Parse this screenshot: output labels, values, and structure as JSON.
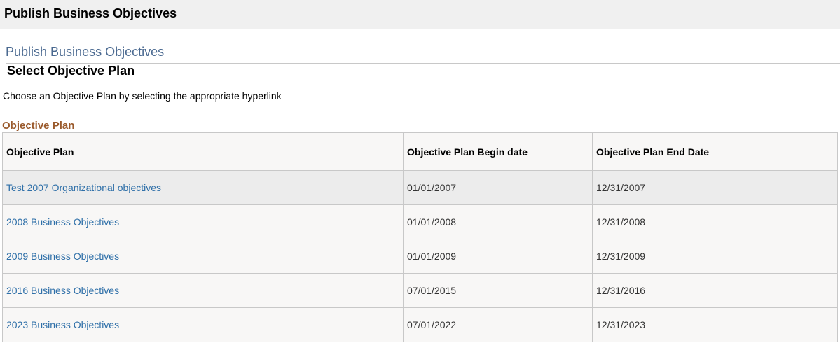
{
  "window": {
    "title": "Publish Business Objectives"
  },
  "page": {
    "heading": "Publish Business Objectives",
    "subheading": "Select Objective Plan",
    "instructions": "Choose an Objective Plan by selecting the appropriate hyperlink"
  },
  "grid": {
    "title": "Objective Plan",
    "columns": [
      "Objective Plan",
      "Objective Plan Begin date",
      "Objective Plan End Date"
    ],
    "rows": [
      {
        "plan": "Test 2007 Organizational objectives",
        "begin": "01/01/2007",
        "end": "12/31/2007"
      },
      {
        "plan": "2008 Business Objectives",
        "begin": "01/01/2008",
        "end": "12/31/2008"
      },
      {
        "plan": "2009 Business Objectives",
        "begin": "01/01/2009",
        "end": "12/31/2009"
      },
      {
        "plan": "2016 Business Objectives",
        "begin": "07/01/2015",
        "end": "12/31/2016"
      },
      {
        "plan": "2023 Business Objectives",
        "begin": "07/01/2022",
        "end": "12/31/2023"
      }
    ]
  },
  "colors": {
    "link": "#2e6fa8",
    "heading": "#4a6990",
    "grid_title": "#9a5a2c",
    "selected_row": "#ececec"
  }
}
